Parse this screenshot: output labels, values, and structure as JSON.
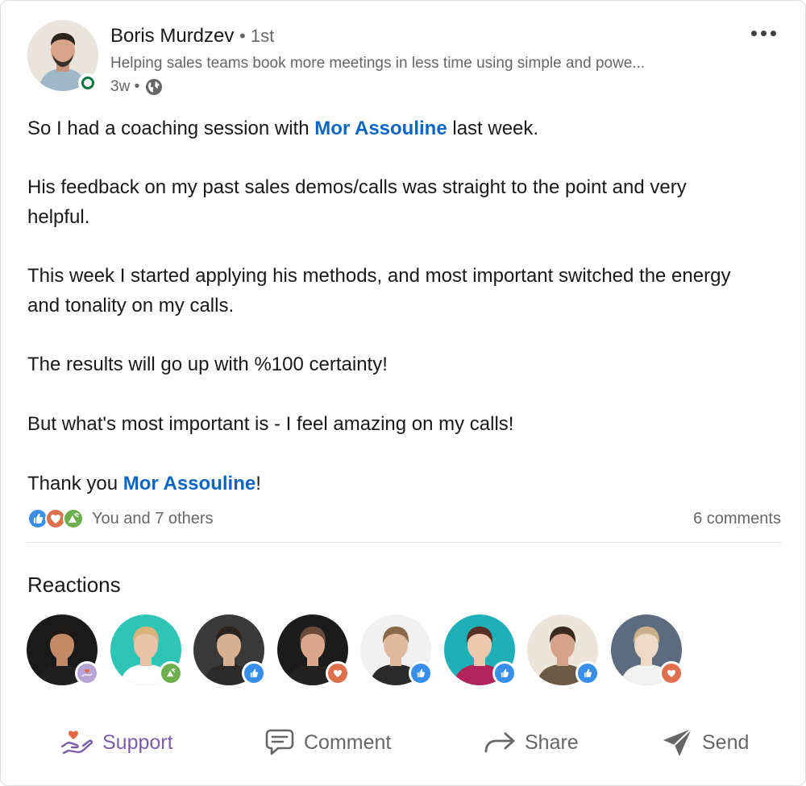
{
  "post": {
    "author_name": "Boris Murdzev",
    "author_degree": "• 1st",
    "headline": "Helping sales teams book more meetings in less time using simple and powe...",
    "time_ago": "3w •",
    "visibility_icon": "globe-icon",
    "paragraphs": [
      {
        "before": "So I had a coaching session with ",
        "mention": "Mor Assouline",
        "after": " last week."
      },
      {
        "text": "His feedback on my past sales demos/calls was straight to the point and very helpful."
      },
      {
        "text": "This week I started applying his methods, and most important switched the energy and tonality on my calls."
      },
      {
        "text": "The results will go up with %100 certainty!"
      },
      {
        "text": "But what's most important is - I feel amazing on my calls!"
      },
      {
        "before": "Thank you ",
        "mention": "Mor Assouline",
        "after": "!"
      }
    ]
  },
  "social": {
    "reaction_types": [
      "like",
      "love",
      "support"
    ],
    "reactions_text": "You and 7 others",
    "comments_text": "6 comments"
  },
  "reactions": {
    "title": "Reactions",
    "people": [
      {
        "reaction": "support",
        "bg": "#1a1a1a",
        "skin": "#c48a68",
        "shirt": "#1f1f1f",
        "hair": "#1e1a18"
      },
      {
        "reaction": "celebrate",
        "bg": "#2ec4b6",
        "skin": "#e8c3a8",
        "shirt": "#ffffff",
        "hair": "#d9b27a"
      },
      {
        "reaction": "like",
        "bg": "#3a3a3a",
        "skin": "#d8b092",
        "shirt": "#2b2b2b",
        "hair": "#2a2420"
      },
      {
        "reaction": "love",
        "bg": "#1b1b1b",
        "skin": "#d9a88c",
        "shirt": "#222222",
        "hair": "#6b4a3a"
      },
      {
        "reaction": "like",
        "bg": "#f1f1f1",
        "skin": "#e0b8a0",
        "shirt": "#2a2a2a",
        "hair": "#8a6a4a"
      },
      {
        "reaction": "like",
        "bg": "#1fb0b7",
        "skin": "#f0c8b0",
        "shirt": "#b0245a",
        "hair": "#5a2e24"
      },
      {
        "reaction": "like",
        "bg": "#ece5da",
        "skin": "#d4a288",
        "shirt": "#6b5a44",
        "hair": "#3a2a1e"
      },
      {
        "reaction": "love",
        "bg": "#5c6b7e",
        "skin": "#f0d8c8",
        "shirt": "#f2f2f2",
        "hair": "#c9b08a"
      }
    ]
  },
  "actions": {
    "support": "Support",
    "comment": "Comment",
    "share": "Share",
    "send": "Send"
  },
  "colors": {
    "link": "#0a66c2",
    "like": "#378fe9",
    "love": "#df704d",
    "support": "#7a5ea8",
    "celebrate": "#44712e",
    "online": "#057642"
  }
}
